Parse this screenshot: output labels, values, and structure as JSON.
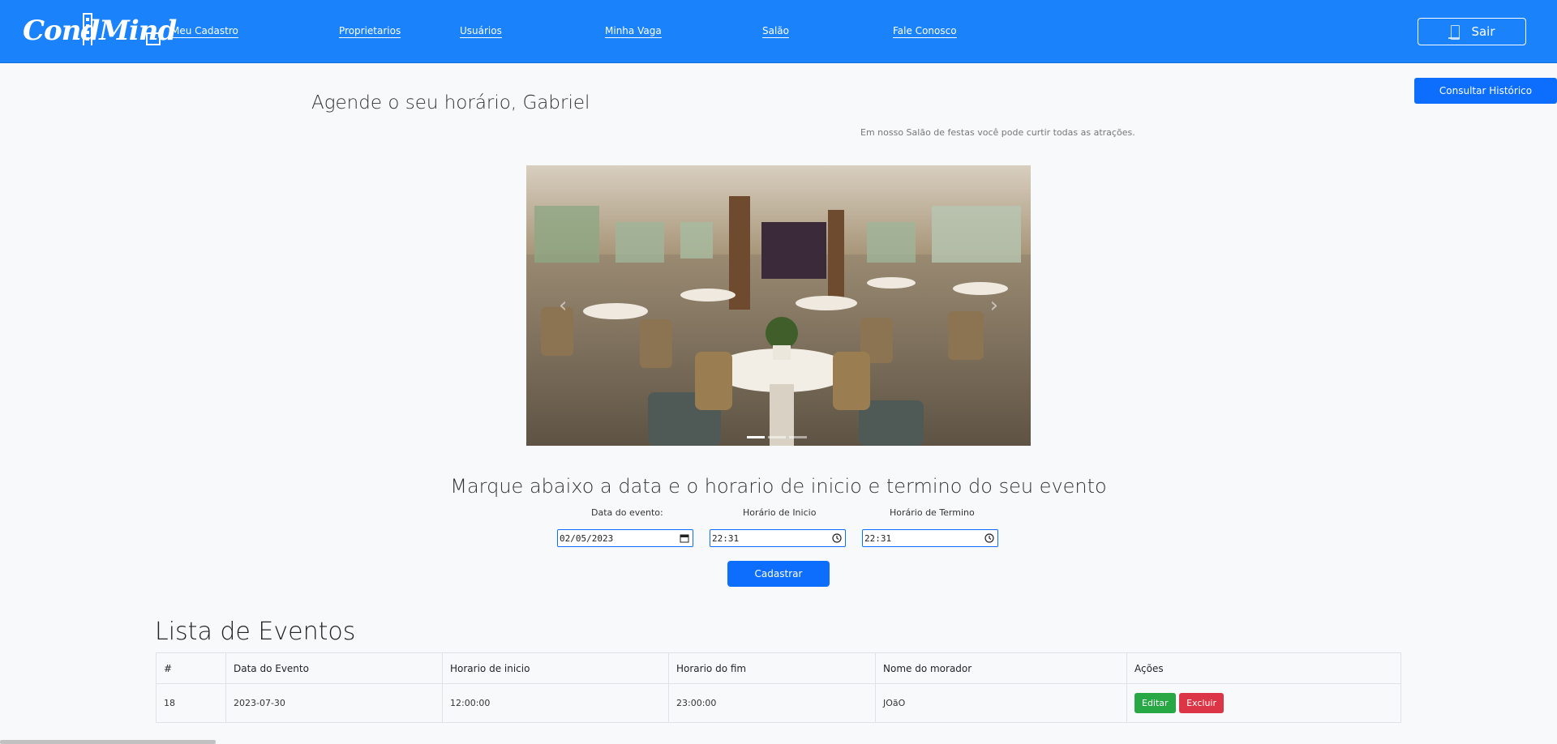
{
  "header": {
    "logo_text": "CondMind",
    "nav": [
      {
        "label": "Meu Cadastro"
      },
      {
        "label": "Proprietarios"
      },
      {
        "label": "Usuários"
      },
      {
        "label": "Minha Vaga"
      },
      {
        "label": "Salão"
      },
      {
        "label": "Fale Conosco"
      }
    ],
    "logout_label": "Sair"
  },
  "actions": {
    "history_label": "Consultar Histórico"
  },
  "main": {
    "title": "Agende o seu horário, Gabriel",
    "subtitle": "Em nosso Salão de festas você pode curtir todas as atrações.",
    "carousel": {
      "slide_count": 3,
      "active_index": 0,
      "prev_icon": "chevron-left-icon",
      "next_icon": "chevron-right-icon"
    },
    "form_title": "Marque abaixo a data e o horario de inicio e termino do seu evento",
    "form": {
      "date_label": "Data do evento:",
      "date_value": "02/05/2023",
      "start_label": "Horário de Inicio",
      "start_value": "22:31",
      "end_label": "Horário de Termino",
      "end_value": "22:31",
      "submit_label": "Cadastrar"
    }
  },
  "events": {
    "title": "Lista de Eventos",
    "columns": [
      "#",
      "Data do Evento",
      "Horario de inicio",
      "Horario do fim",
      "Nome do morador",
      "Ações"
    ],
    "rows": [
      {
        "id": "18",
        "date": "2023-07-30",
        "start": "12:00:00",
        "end": "23:00:00",
        "resident": "JOãO",
        "edit_label": "Editar",
        "delete_label": "Excluir"
      }
    ]
  },
  "colors": {
    "navbar": "#1a82fb",
    "primary": "#0d6efd",
    "success": "#28a745",
    "danger": "#dc3545",
    "background": "#f8f9fa"
  }
}
